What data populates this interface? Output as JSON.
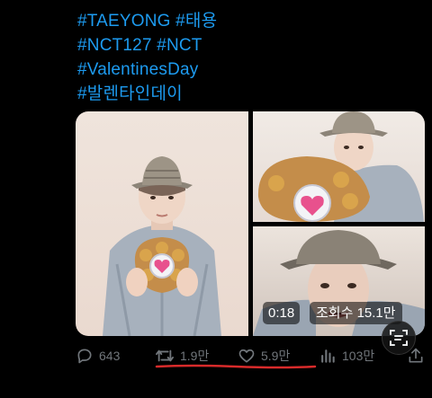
{
  "tweet": {
    "hashtag_lines": [
      "#TAEYONG #태용",
      "#NCT127 #NCT",
      "#ValentinesDay",
      "#발렌타인데이"
    ]
  },
  "media": {
    "video_time": "0:18",
    "view_count": "조회수 15.1만"
  },
  "actions": {
    "replies": "643",
    "retweets": "1.9만",
    "likes": "5.9만",
    "views": "103만"
  },
  "colors": {
    "hashtag": "#1d9bf0",
    "action_text": "#71767b",
    "annotation_underline": "#d92b2b"
  },
  "icons": [
    "reply-icon",
    "retweet-icon",
    "like-icon",
    "views-icon",
    "share-icon",
    "lens-icon",
    "heart-chocolate-box"
  ]
}
